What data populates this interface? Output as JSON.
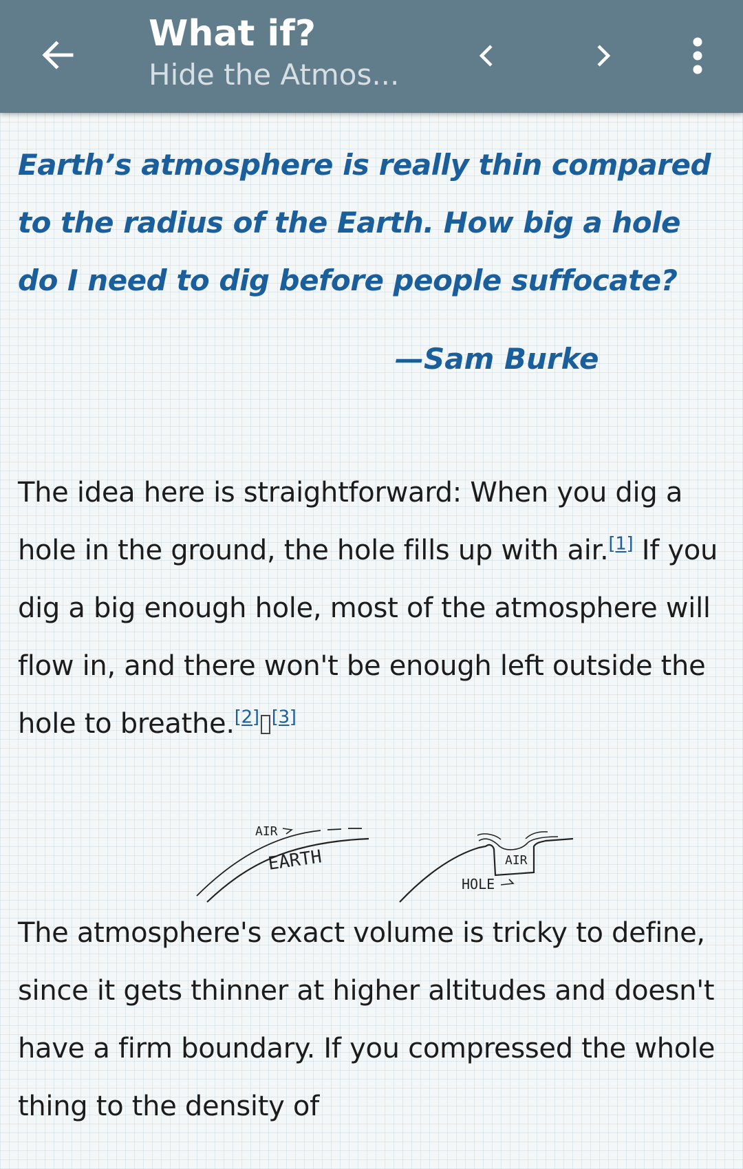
{
  "appbar": {
    "title": "What if?",
    "subtitle": "Hide the Atmos...",
    "back_icon": "arrow-left-icon",
    "prev_icon": "chevron-left-icon",
    "next_icon": "chevron-right-icon",
    "more_icon": "more-vert-icon",
    "background_color": "#617c8a"
  },
  "article": {
    "question": "Earth’s atmosphere is really thin compared to the radius of the Earth. How big a hole do I need to dig before people suffocate?",
    "attribution": "—Sam Burke",
    "paragraph1": {
      "text_a": "The idea here is straightforward: When you dig a hole in the ground, the hole fills up with air.",
      "footnote_1": "[1]",
      "text_b": " If you dig a big enough hole, most of the atmosphere will flow in, and there won't be enough left outside the hole to breathe.",
      "footnote_2": "[2]",
      "footnote_3": "[3]"
    },
    "comic": {
      "label_air_left": "AIR",
      "label_earth": "EARTH",
      "label_air_right": "AIR",
      "label_hole": "HOLE"
    },
    "paragraph2": "The atmosphere's exact volume is tricky to define, since it gets thinner at higher altitudes and doesn't have a firm boundary. If you compressed the whole thing to the density of"
  },
  "colors": {
    "accent": "#1a5f9c",
    "body_text": "#1c1c1c",
    "page_background": "#f4f7f7"
  }
}
